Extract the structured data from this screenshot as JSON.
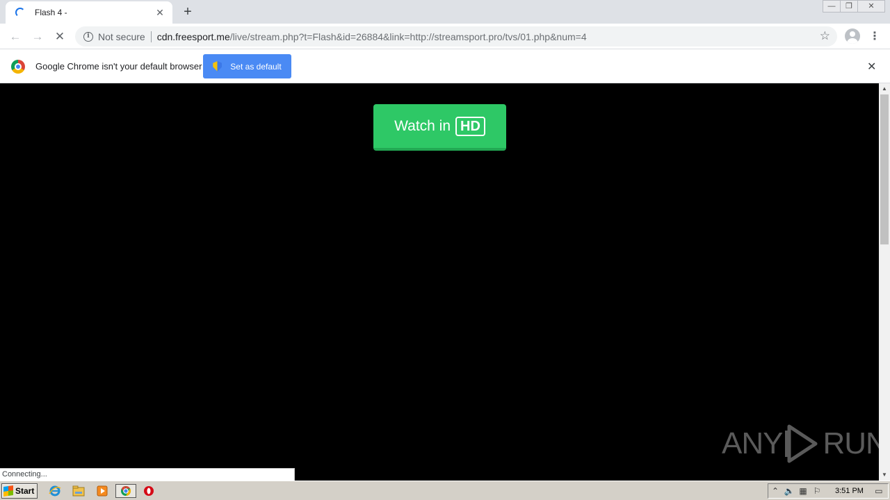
{
  "tab": {
    "title": "Flash 4 -",
    "close_glyph": "✕",
    "new_tab_glyph": "+"
  },
  "window_controls": {
    "minimize": "—",
    "restore": "❐",
    "close": "✕"
  },
  "toolbar": {
    "back_glyph": "←",
    "forward_glyph": "→",
    "stop_glyph": "✕",
    "security_icon": "info-icon",
    "security_label": "Not secure",
    "url_host": "cdn.freesport.me",
    "url_path": "/live/stream.php?t=Flash&id=26884&link=http://streamsport.pro/tvs/01.php&num=4",
    "star_glyph": "☆",
    "menu_glyph": "⋮"
  },
  "infobar": {
    "message": "Google Chrome isn't your default browser",
    "button_label": "Set as default",
    "close_glyph": "✕"
  },
  "content": {
    "watch_label": "Watch in",
    "hd_label": "HD",
    "background_color": "#000000",
    "button_color": "#2ec866"
  },
  "watermark": {
    "left": "ANY",
    "right": "RUN"
  },
  "status_text": "Connecting...",
  "scrollbar": {
    "up_glyph": "▲",
    "down_glyph": "▼"
  },
  "taskbar": {
    "start_label": "Start",
    "apps": [
      "ie-icon",
      "explorer-icon",
      "media-player-icon",
      "chrome-icon",
      "opera-icon"
    ],
    "tray_icons": [
      "show-hidden-icon",
      "volume-icon",
      "network-icon",
      "action-center-flag-icon"
    ],
    "clock": "3:51 PM"
  }
}
